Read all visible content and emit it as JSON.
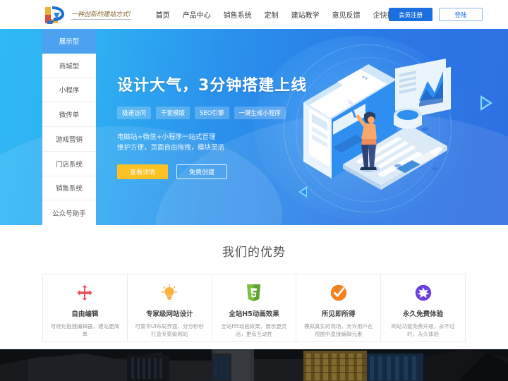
{
  "header": {
    "logo_tagline": "一种创新的建站方式!",
    "logo_icon": "logo-mark-icon",
    "nav": [
      {
        "label": "首页"
      },
      {
        "label": "产品中心"
      },
      {
        "label": "销售系统"
      },
      {
        "label": "定制"
      },
      {
        "label": "建站教学"
      },
      {
        "label": "意见反馈"
      },
      {
        "label": "企快推"
      }
    ],
    "register_label": "会员注册",
    "login_label": "登陆",
    "register_color": "#1b6fe0",
    "login_border_color": "#8fb8ee"
  },
  "sidebar": {
    "items": [
      {
        "label": "展示型",
        "active": true
      },
      {
        "label": "商城型",
        "active": false
      },
      {
        "label": "小程序",
        "active": false
      },
      {
        "label": "微传单",
        "active": false
      },
      {
        "label": "游戏营销",
        "active": false
      },
      {
        "label": "门店系统",
        "active": false
      },
      {
        "label": "销售系统",
        "active": false
      },
      {
        "label": "公众号助手",
        "active": false
      }
    ],
    "active_color": "#4da2f0"
  },
  "hero": {
    "title": "设计大气，3分钟搭建上线",
    "tags": [
      {
        "label": "极速访问"
      },
      {
        "label": "千套模版"
      },
      {
        "label": "SEO引擎"
      },
      {
        "label": "一键生成小程序"
      }
    ],
    "desc_line1": "电脑站+微信+小程序一站式管理",
    "desc_line2": "维护方便，页面自由拖拽，模块灵活",
    "primary_button": "查看详情",
    "secondary_button": "免费创建",
    "primary_color": "#fdc123",
    "bg_start": "#2fb8f5",
    "bg_end": "#2f6fe2",
    "illustration": "isometric-web-design-illustration"
  },
  "advantages": {
    "title": "我们的优势",
    "cards": [
      {
        "icon": "move-arrows-icon",
        "color": "#ef4b5e",
        "title": "自由编辑",
        "desc": "可视化拖拽编辑器，建站更简单"
      },
      {
        "icon": "lightbulb-icon",
        "color": "#fbb040",
        "title": "专家级网站设计",
        "desc": "可豪华UI布局界面，分分秒秒打造专家级网站"
      },
      {
        "icon": "html5-shield-icon",
        "color": "#7ac143",
        "title": "全站H5动画效果",
        "desc": "全站H5动画效果，展示更灵活，更有互动性"
      },
      {
        "icon": "check-circle-icon",
        "color": "#f58220",
        "title": "所见即所得",
        "desc": "模拟真实的现场，允许用户在视图中直接编辑元素"
      },
      {
        "icon": "free-badge-icon",
        "color": "#6c3fe0",
        "title": "永久免费体验",
        "desc": "网站功能免费升级，永不过时，永久体验"
      }
    ]
  },
  "footer": {
    "banner_image": "dark-city-buildings-photo"
  }
}
